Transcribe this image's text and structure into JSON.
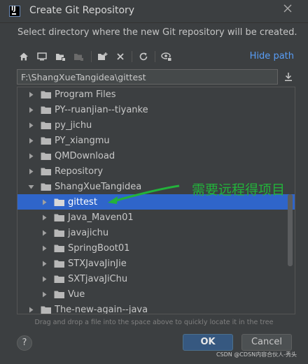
{
  "window": {
    "title": "Create Git Repository",
    "app_icon": "intellij-icon",
    "close_icon": "close-icon"
  },
  "subtitle": "Select directory where the new Git repository will be created.",
  "toolbar": {
    "icons": [
      "home-icon",
      "desktop-icon",
      "project-folder-icon",
      "module-folder-icon",
      "new-folder-icon",
      "delete-icon",
      "refresh-icon",
      "show-hidden-icon"
    ],
    "hide_path_label": "Hide path"
  },
  "path": {
    "value": "F:\\ShangXueTangidea\\gittest",
    "download_icon": "download-icon"
  },
  "tree": {
    "items": [
      {
        "label": "Program Files",
        "expanded": false,
        "level": 0,
        "selected": false
      },
      {
        "label": "PY--ruanjian--tiyanke",
        "expanded": false,
        "level": 0,
        "selected": false
      },
      {
        "label": "py_jichu",
        "expanded": false,
        "level": 0,
        "selected": false
      },
      {
        "label": "PY_xiangmu",
        "expanded": false,
        "level": 0,
        "selected": false
      },
      {
        "label": "QMDownload",
        "expanded": false,
        "level": 0,
        "selected": false
      },
      {
        "label": "Repository",
        "expanded": false,
        "level": 0,
        "selected": false
      },
      {
        "label": "ShangXueTangidea",
        "expanded": true,
        "level": 0,
        "selected": false
      },
      {
        "label": "gittest",
        "expanded": false,
        "level": 1,
        "selected": true
      },
      {
        "label": "Java_Maven01",
        "expanded": false,
        "level": 1,
        "selected": false
      },
      {
        "label": "javajichu",
        "expanded": false,
        "level": 1,
        "selected": false
      },
      {
        "label": "SpringBoot01",
        "expanded": false,
        "level": 1,
        "selected": false
      },
      {
        "label": "STXJavaJinJie",
        "expanded": false,
        "level": 1,
        "selected": false
      },
      {
        "label": "SXTjavaJiChu",
        "expanded": false,
        "level": 1,
        "selected": false
      },
      {
        "label": "Vue",
        "expanded": false,
        "level": 1,
        "selected": false
      },
      {
        "label": "The-new-again--java",
        "expanded": false,
        "level": 0,
        "selected": false
      }
    ]
  },
  "annotation": {
    "text": "需要远程得项目",
    "color": "#23b23b"
  },
  "hint": "Drag and drop a file into the space above to quickly locate it in the tree",
  "buttons": {
    "help": "?",
    "ok": "OK",
    "cancel": "Cancel"
  },
  "watermark": "CSDN @CDSN内容合伙人-秀头",
  "colors": {
    "background": "#3c3f41",
    "selection": "#2f65ca",
    "link": "#589df6",
    "ok_button": "#365880"
  }
}
